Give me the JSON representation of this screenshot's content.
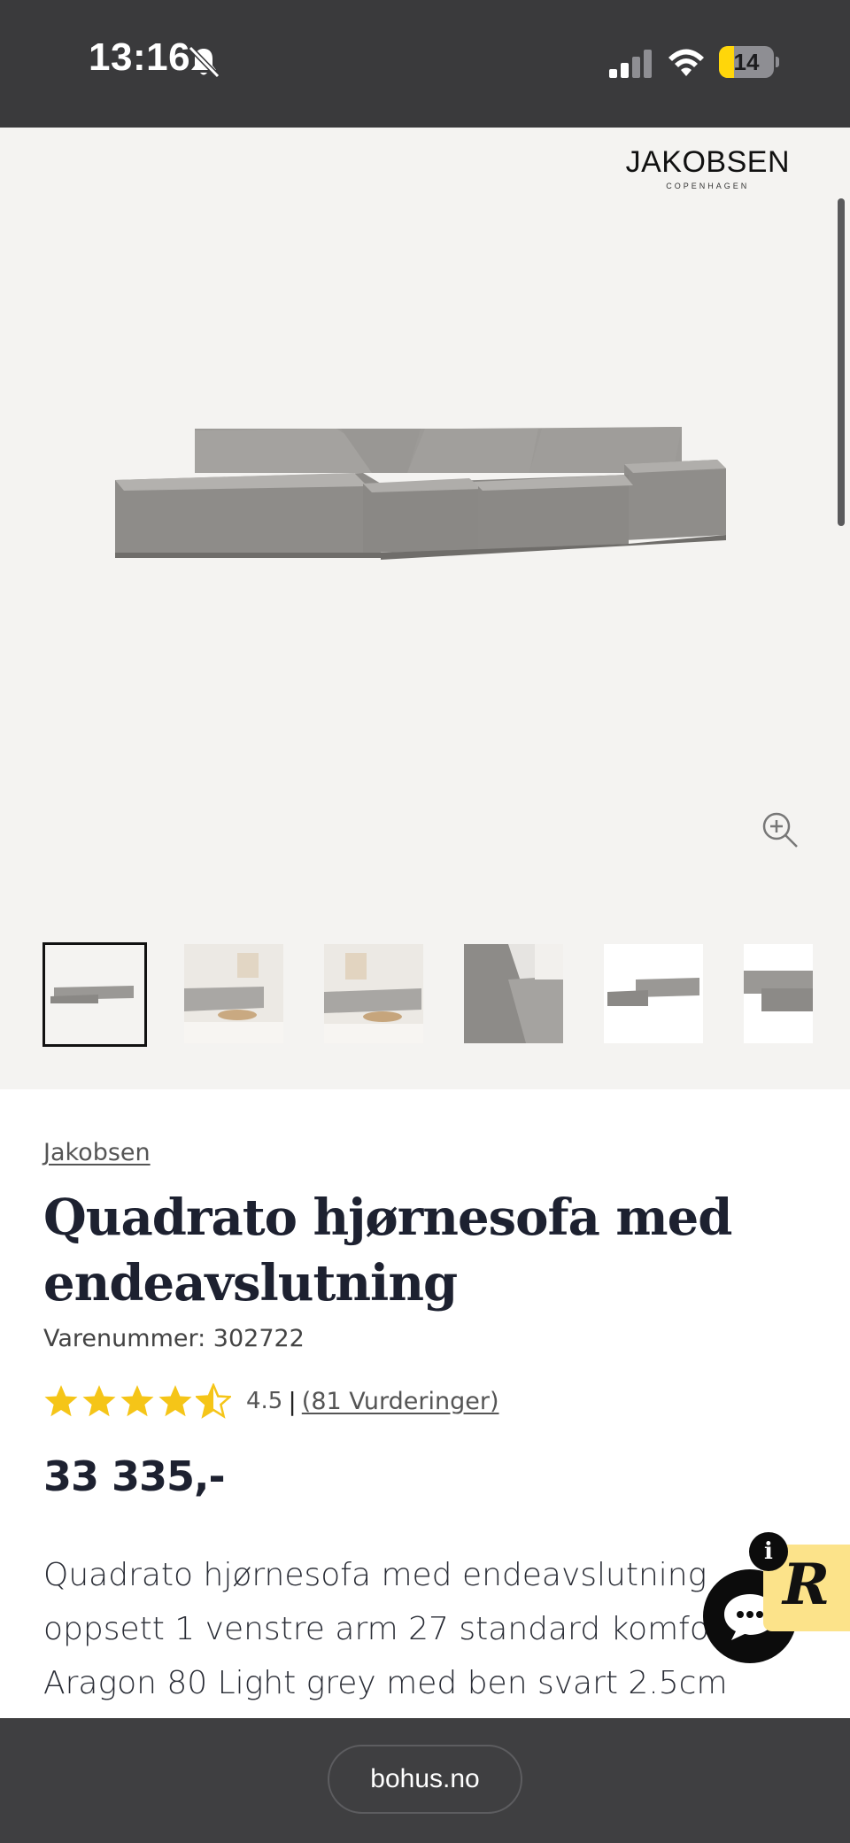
{
  "status_bar": {
    "time": "13:16",
    "battery_level": 0.14,
    "battery_label": "14"
  },
  "gallery": {
    "brand_logo": {
      "name": "JAKOBSEN",
      "subtitle": "COPENHAGEN"
    },
    "thumbnails": [
      {
        "label": "sofa-studio",
        "active": true
      },
      {
        "label": "sofa-room-1",
        "active": false
      },
      {
        "label": "sofa-room-2",
        "active": false
      },
      {
        "label": "sofa-closeup",
        "active": false
      },
      {
        "label": "sofa-angle",
        "active": false
      },
      {
        "label": "sofa-partial",
        "active": false
      }
    ]
  },
  "product": {
    "brand_link": "Jakobsen",
    "title": "Quadrato hjørnesofa med endeavslutning",
    "sku": "Varenummer: 302722",
    "rating": {
      "value_label": "4.5",
      "value": 4.5,
      "max": 5,
      "separator": "|",
      "count_label": "(81 Vurderinger)"
    },
    "price": "33 335,-",
    "description": "Quadrato hjørnesofa med endeavslutning oppsett 1 venstre arm 27 standard komfort Aragon 80 Light grey med ben svart 2.5cm"
  },
  "widgets": {
    "info_badge": "i",
    "r_widget": "R"
  },
  "browser_bar": {
    "url": "bohus.no"
  },
  "colors": {
    "status_bar_bg": "#3a3a3c",
    "gallery_bg": "#f4f3f1",
    "star": "#f5c518",
    "title": "#1d2130",
    "r_widget_bg": "#fce38a",
    "battery": "#ffd60a"
  }
}
